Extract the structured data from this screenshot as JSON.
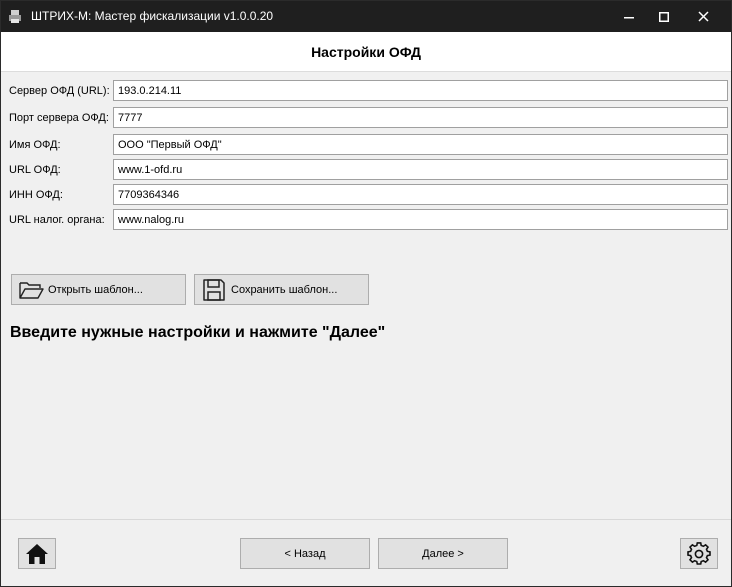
{
  "window": {
    "title": "ШТРИХ-М: Мастер фискализации v1.0.0.20",
    "controls": [
      "minimize",
      "maximize",
      "close"
    ]
  },
  "header": {
    "title": "Настройки ОФД"
  },
  "form": {
    "fields": [
      {
        "label": "Сервер ОФД (URL):",
        "value": "193.0.214.11"
      },
      {
        "label": "Порт сервера ОФД:",
        "value": "7777"
      },
      {
        "label": "Имя ОФД:",
        "value": "ООО \"Первый ОФД\""
      },
      {
        "label": "URL ОФД:",
        "value": "www.1-ofd.ru"
      },
      {
        "label": "ИНН ОФД:",
        "value": "7709364346"
      },
      {
        "label": "URL налог. органа:",
        "value": "www.nalog.ru"
      }
    ]
  },
  "templates": {
    "open_label": "Открыть шаблон...",
    "save_label": "Сохранить шаблон..."
  },
  "instruction": "Введите нужные настройки и нажмите  \"Далее\"",
  "footer": {
    "back_label": "< Назад",
    "next_label": "Далее >",
    "home_icon": "home-icon",
    "settings_icon": "gear-icon"
  }
}
